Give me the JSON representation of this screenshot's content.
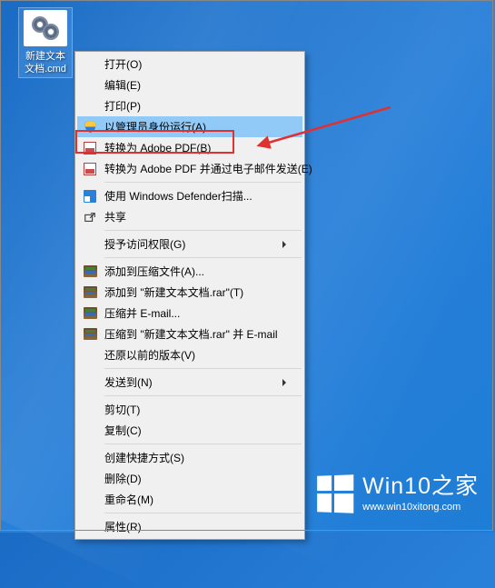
{
  "desktop": {
    "icon_label": "新建文本文档.cmd"
  },
  "menu": {
    "open": "打开(O)",
    "edit": "编辑(E)",
    "print": "打印(P)",
    "run_as_admin": "以管理员身份运行(A)",
    "convert_pdf": "转换为 Adobe PDF(B)",
    "convert_pdf_email": "转换为 Adobe PDF 并通过电子邮件发送(E)",
    "defender_scan": "使用 Windows Defender扫描...",
    "share": "共享",
    "grant_access": "授予访问权限(G)",
    "add_to_archive": "添加到压缩文件(A)...",
    "add_to_rar": "添加到 \"新建文本文档.rar\"(T)",
    "compress_email": "压缩并 E-mail...",
    "compress_rar_email": "压缩到 \"新建文本文档.rar\" 并 E-mail",
    "restore_versions": "还原以前的版本(V)",
    "send_to": "发送到(N)",
    "cut": "剪切(T)",
    "copy": "复制(C)",
    "create_shortcut": "创建快捷方式(S)",
    "delete": "删除(D)",
    "rename": "重命名(M)",
    "properties": "属性(R)"
  },
  "watermark": {
    "title": "Win10之家",
    "url": "www.win10xitong.com"
  }
}
